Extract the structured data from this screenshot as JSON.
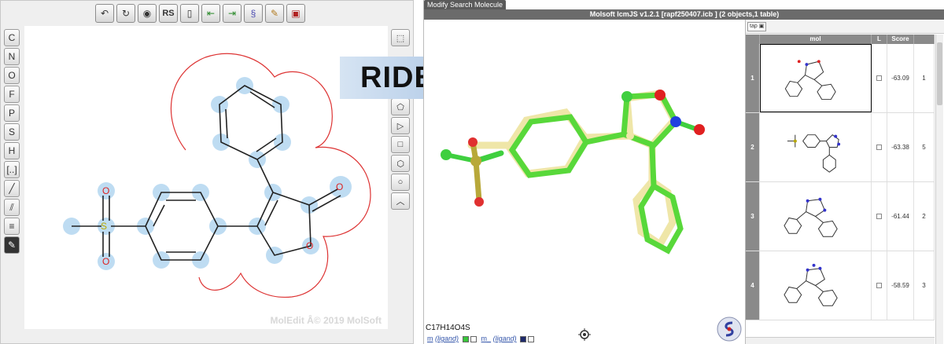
{
  "ride_label": "RIDE",
  "moledit": {
    "watermark": "MolEdit Â© 2019 MolSoft",
    "toolbar": [
      "undo-icon",
      "redo-icon",
      "target-icon",
      "Rs",
      "document-icon",
      "import-icon",
      "export-icon",
      "molsoft-icon",
      "edit-icon",
      "book-icon"
    ],
    "toolbar_rs_label": "RS",
    "left_tools": [
      "C",
      "N",
      "O",
      "F",
      "P",
      "S",
      "H",
      "[..]",
      "single-bond",
      "double-bond",
      "triple-bond",
      "pencil"
    ],
    "right_tools": [
      "select-icon",
      "hexagon-aromatic",
      "pentagon",
      "triangle",
      "square",
      "hexagon",
      "heptagon",
      "chain"
    ],
    "atom_labels": {
      "s": "S",
      "o": "O"
    }
  },
  "icm": {
    "tab_label": "Modify Search Molecule",
    "title": "Molsoft IcmJS v1.2.1 [rapf250407.icb ] (2 objects,1 table)",
    "formula": "C17H14O4S",
    "objects": [
      {
        "name": "m",
        "type": "(ligand)"
      },
      {
        "name": "m_",
        "type": "(ligand)"
      }
    ],
    "table": {
      "tab_label": "tap",
      "columns": [
        "",
        "mol",
        "L",
        "Score",
        ""
      ],
      "rows": [
        {
          "num": "1",
          "score": "-63.09",
          "extra": "1"
        },
        {
          "num": "2",
          "score": "-63.38",
          "extra": "5"
        },
        {
          "num": "3",
          "score": "-61.44",
          "extra": "2"
        },
        {
          "num": "4",
          "score": "-58.59",
          "extra": "3"
        }
      ]
    }
  }
}
